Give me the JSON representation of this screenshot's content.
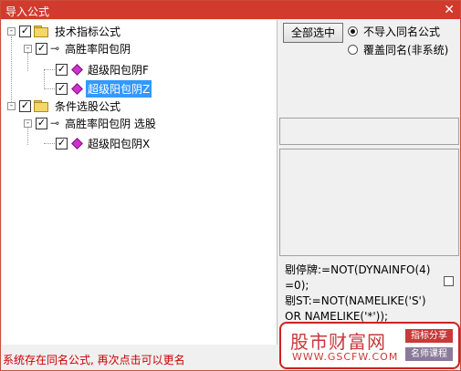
{
  "window": {
    "title": "导入公式",
    "close_glyph": "✕"
  },
  "tree": {
    "root1": {
      "label": "技术指标公式",
      "expander": "-",
      "check": "✓"
    },
    "group1": {
      "label": "高胜率阳包阴",
      "expander": "-",
      "check": "✓"
    },
    "item1": {
      "label": "超级阳包阴F",
      "check": "✓"
    },
    "item2": {
      "label": "超级阳包阴Z",
      "check": "✓"
    },
    "root2": {
      "label": "条件选股公式",
      "expander": "-",
      "check": "✓"
    },
    "group2": {
      "label": "高胜率阳包阴   选股",
      "expander": "-",
      "check": "✓"
    },
    "item3": {
      "label": "超级阳包阴X",
      "check": "✓"
    }
  },
  "controls": {
    "select_all": "全部选中",
    "radio_no_import": "不导入同名公式",
    "radio_overwrite": "覆盖同名(非系统)"
  },
  "code": {
    "line1": "剔停牌:=NOT(DYNAINFO(4)",
    "line2": "=0);",
    "line3": "剔ST:=NOT(NAMELIKE('S')",
    "line4": "OR NAMELIKE('*'));"
  },
  "status": "系统存在同名公式, 再次点击可以更名",
  "watermark": {
    "brand": "股市财富网",
    "url": "WWW.GSCFW.COM",
    "tag1": "指标分享",
    "tag2": "名师课程"
  }
}
